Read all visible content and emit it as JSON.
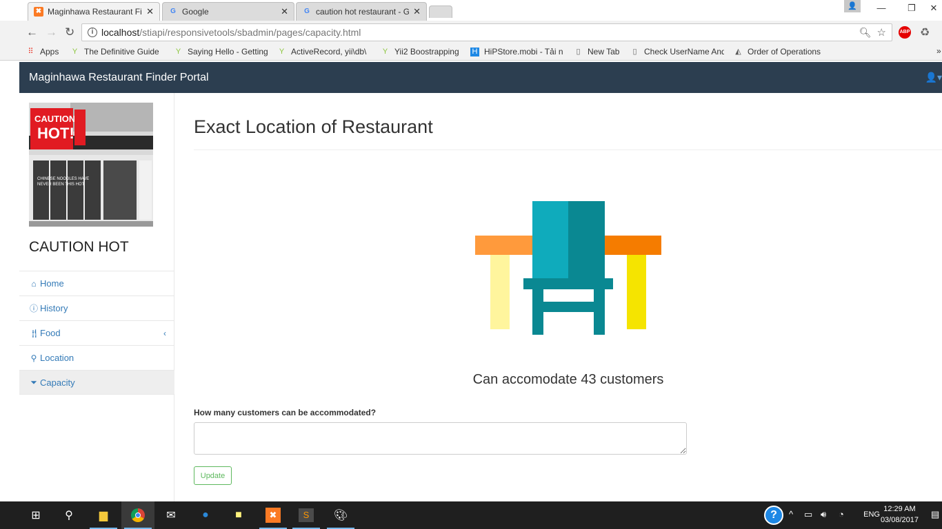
{
  "browser": {
    "tabs": [
      {
        "title": "Maginhawa Restaurant Finder Portal",
        "icon": "xampp-icon",
        "active": true
      },
      {
        "title": "Google",
        "icon": "google-icon",
        "active": false
      },
      {
        "title": "caution hot restaurant - Google Search",
        "icon": "google-icon",
        "active": false
      }
    ],
    "address": {
      "host": "localhost",
      "path": "/stiapi/responsivetools/sbadmin/pages/capacity.html"
    },
    "bookmarks": [
      {
        "label": "Apps",
        "icon": "apps-grid-icon"
      },
      {
        "label": "The Definitive Guide",
        "icon": "yii-icon"
      },
      {
        "label": "Saying Hello - Getting",
        "icon": "yii-icon"
      },
      {
        "label": "ActiveRecord, yii\\db\\",
        "icon": "yii-icon"
      },
      {
        "label": "Yii2 Boostrapping",
        "icon": "yii-icon"
      },
      {
        "label": "HiPStore.mobi - Tải n",
        "icon": "hipstore-icon"
      },
      {
        "label": "New Tab",
        "icon": "page-icon"
      },
      {
        "label": "Check UserName And",
        "icon": "page-icon"
      },
      {
        "label": "Order of Operations",
        "icon": "math-icon"
      }
    ],
    "bookmarks_more": "»"
  },
  "portal": {
    "brand": "Maginhawa Restaurant Finder Portal",
    "user_menu_icon": "user-icon"
  },
  "sidebar": {
    "restaurant_name": "CAUTION HOT",
    "photo_text": {
      "sign_line1": "CAUTION",
      "sign_line2": "HOT!",
      "window_text": "CHINESE NOODLES HAVE NEVER BEEN THIS HOT"
    },
    "items": [
      {
        "label": "Home",
        "icon": "home-icon",
        "active": false
      },
      {
        "label": "History",
        "icon": "info-icon",
        "active": false
      },
      {
        "label": "Food",
        "icon": "cutlery-icon",
        "active": false,
        "has_submenu": true
      },
      {
        "label": "Location",
        "icon": "map-marker-icon",
        "active": false
      },
      {
        "label": "Capacity",
        "icon": "filter-icon",
        "active": true
      }
    ],
    "submenu_chevron": "‹"
  },
  "main": {
    "heading": "Exact Location of Restaurant",
    "caption": "Can accomodate 43 customers",
    "question_label": "How many customers can be accommodated?",
    "answer_value": "",
    "update_label": "Update"
  },
  "taskbar": {
    "time": "12:29 AM",
    "date": "03/08/2017",
    "language": "ENG",
    "apps": [
      "start-icon",
      "search-icon",
      "file-explorer-icon",
      "chrome-icon",
      "mail-icon",
      "messaging-icon",
      "sticky-notes-icon",
      "xampp-icon",
      "sublime-icon",
      "paint-icon"
    ]
  },
  "colors": {
    "navbar": "#2c3e50",
    "link": "#337ab7",
    "success": "#5cb85c",
    "chair_light": "#0fabbc",
    "chair_dark": "#0a8892",
    "table_light": "#ff9a3c",
    "table_dark": "#f57c00",
    "leg_light": "#fff59d",
    "leg_dark": "#f5e400"
  }
}
